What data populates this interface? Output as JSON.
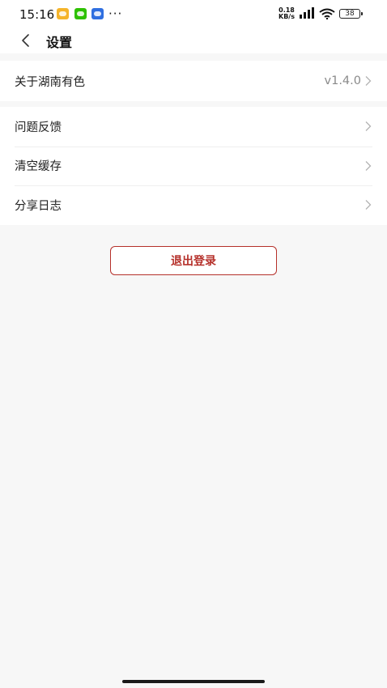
{
  "status_bar": {
    "time": "15:16",
    "more": "···",
    "net_speed_value": "0.18",
    "net_speed_unit": "KB/s",
    "battery": "38",
    "app_icons": [
      "notes-app-icon",
      "wechat-icon",
      "app-icon"
    ]
  },
  "nav": {
    "title": "设置"
  },
  "settings": {
    "about": {
      "label": "关于湖南有色",
      "value": "v1.4.0"
    },
    "feedback": {
      "label": "问题反馈"
    },
    "clear_cache": {
      "label": "清空缓存"
    },
    "share_log": {
      "label": "分享日志"
    }
  },
  "logout_label": "退出登录",
  "colors": {
    "accent": "#b5302a",
    "background": "#f7f7f7",
    "card": "#ffffff"
  }
}
